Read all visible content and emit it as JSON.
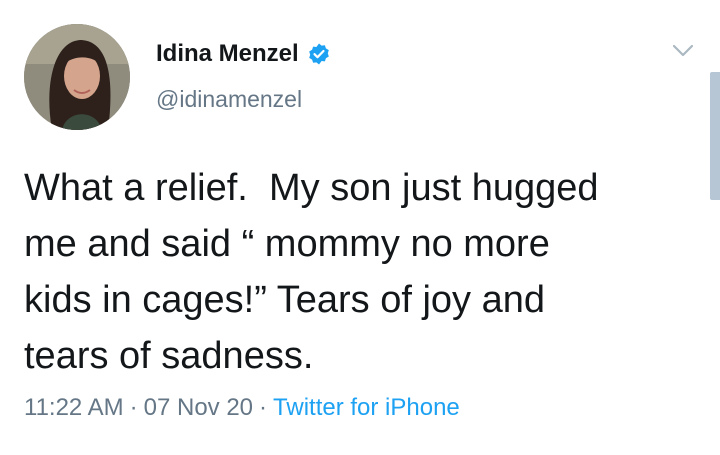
{
  "user": {
    "display_name": "Idina Menzel",
    "handle": "@idinamenzel",
    "avatar_icon": "profile-photo",
    "verified_icon": "verified-badge-icon"
  },
  "tweet": {
    "text": "What a relief.  My son just hugged\nme and said “ mommy no more\nkids in cages!” Tears of joy and\ntears of sadness."
  },
  "meta": {
    "time": "11:22 AM",
    "separator": "·",
    "date": "07 Nov 20",
    "source": "Twitter for iPhone"
  },
  "colors": {
    "text": "#14171a",
    "secondary": "#657786",
    "link": "#1da1f2",
    "verified": "#1da1f2"
  }
}
